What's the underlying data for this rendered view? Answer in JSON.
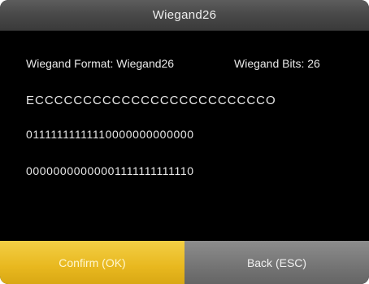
{
  "window": {
    "title": "Wiegand26"
  },
  "info": {
    "format_text": "Wiegand Format: Wiegand26",
    "bits_text": "Wiegand Bits: 26"
  },
  "codes": {
    "parity_line": "ECCCCCCCCCCCCCCCCCCCCCCCCO",
    "mask_line_1": "01111111111110000000000000",
    "mask_line_2": "00000000000001111111111110"
  },
  "buttons": {
    "confirm_label": "Confirm (OK)",
    "back_label": "Back (ESC)"
  },
  "colors": {
    "confirm_accent": "#e8b81f",
    "back_gray": "#747474",
    "background": "#000000"
  }
}
